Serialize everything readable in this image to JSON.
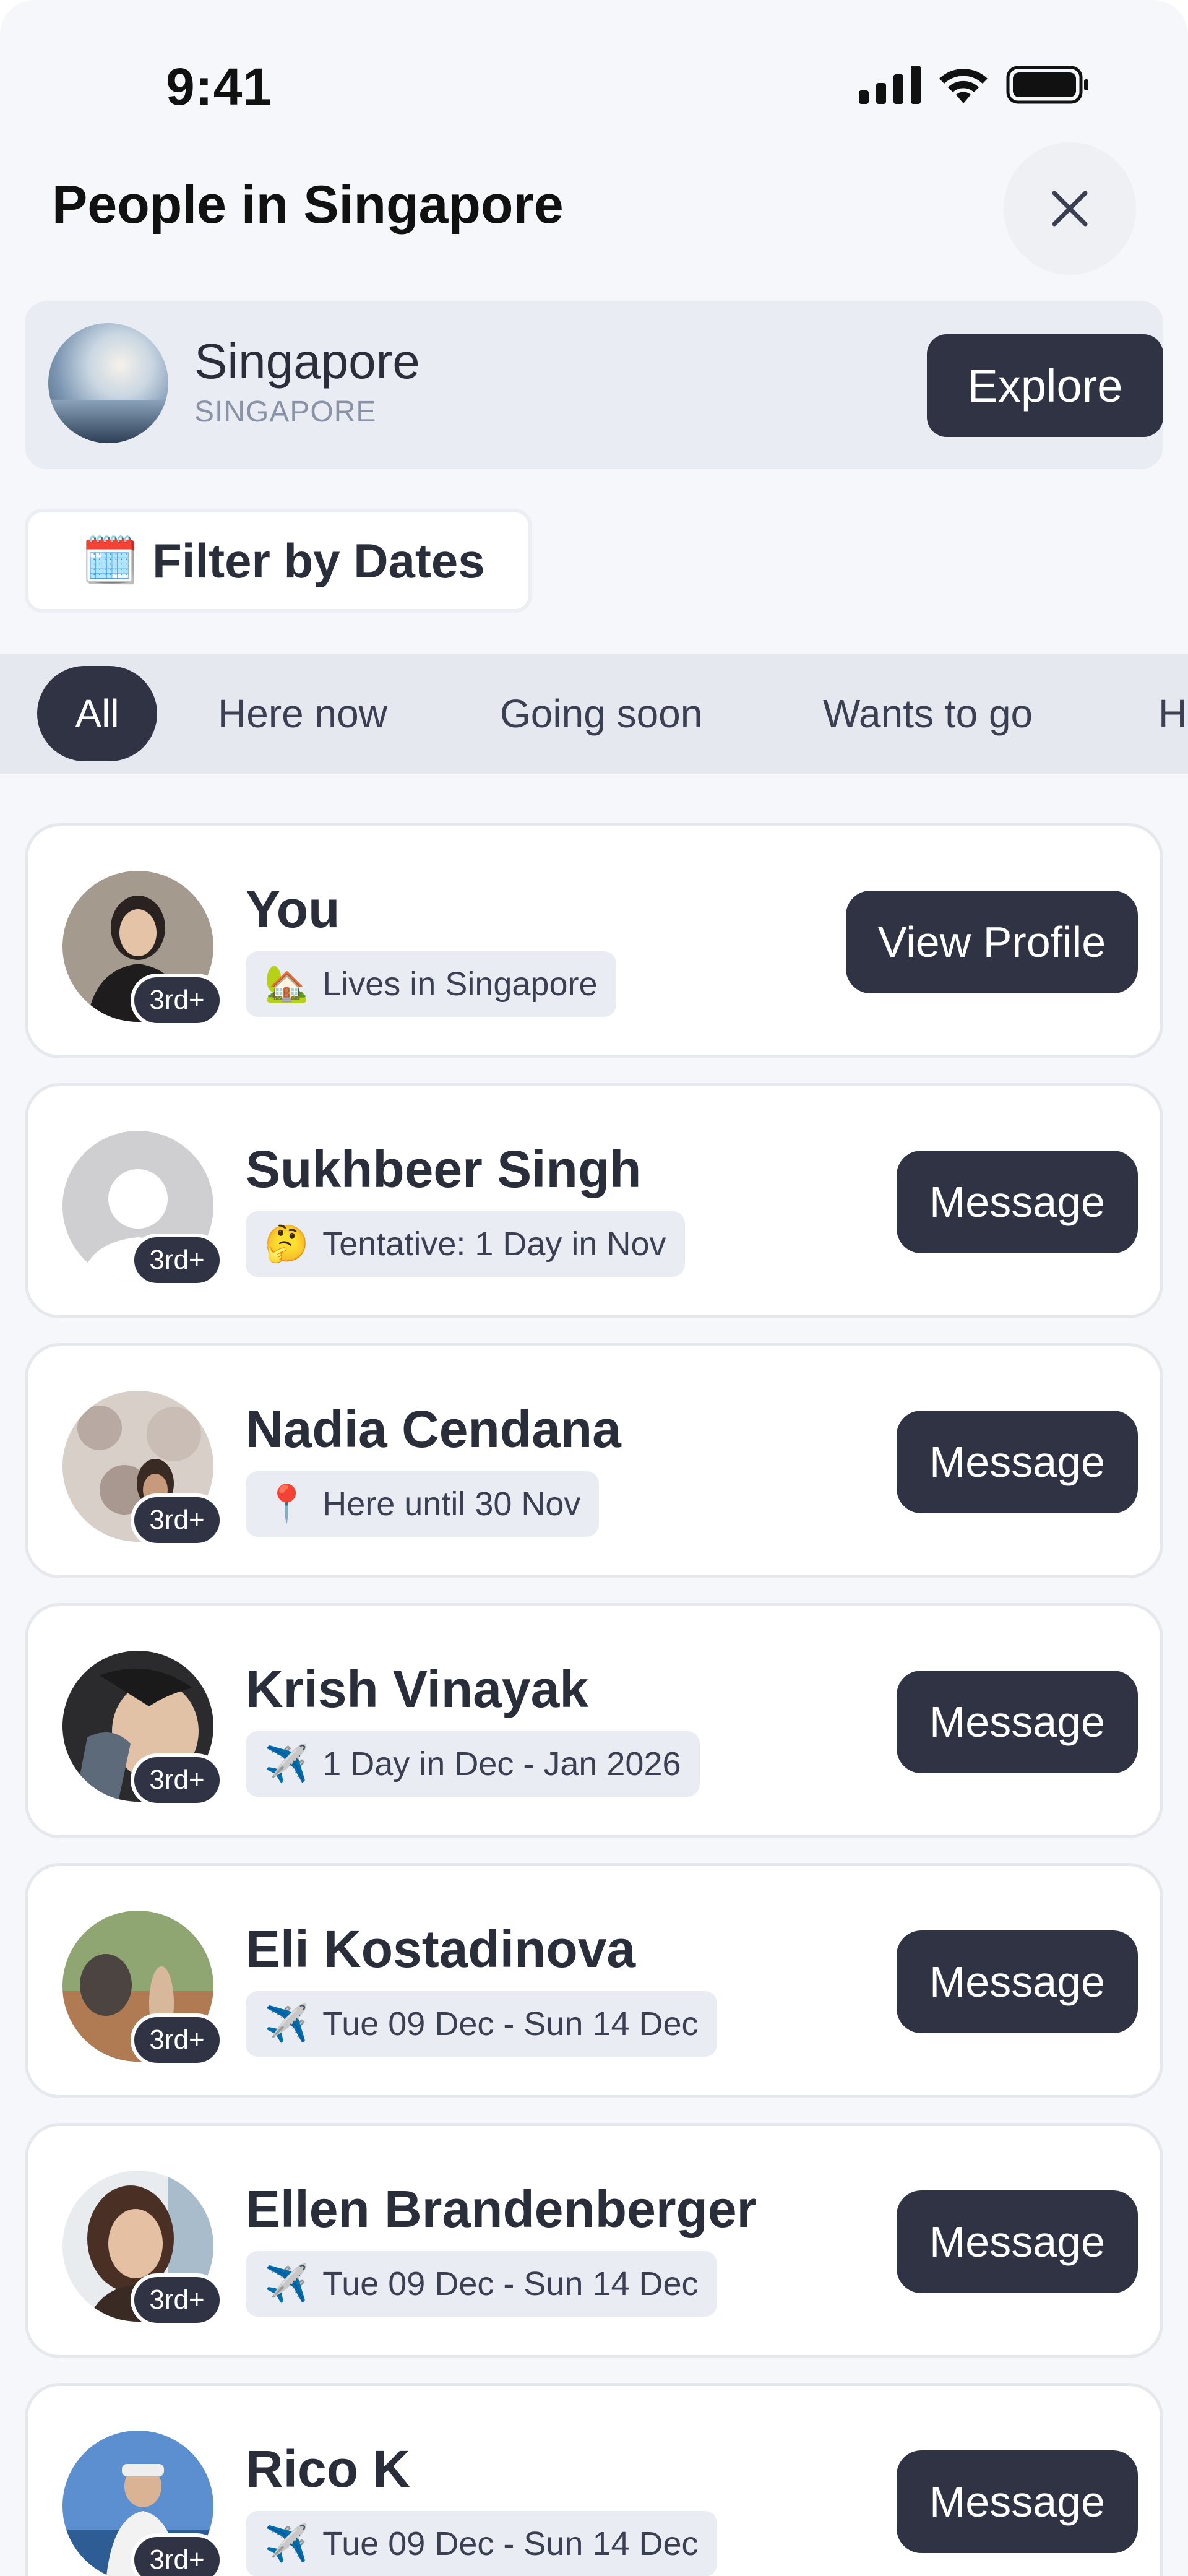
{
  "status_bar": {
    "time": "9:41"
  },
  "header": {
    "title": "People in Singapore"
  },
  "location": {
    "name": "Singapore",
    "country": "SINGAPORE",
    "explore_label": "Explore"
  },
  "filter": {
    "icon": "🗓️",
    "label": "Filter by Dates"
  },
  "tabs": [
    {
      "label": "All",
      "active": true
    },
    {
      "label": "Here now",
      "active": false
    },
    {
      "label": "Going soon",
      "active": false
    },
    {
      "label": "Wants to go",
      "active": false
    },
    {
      "label": "H",
      "active": false
    }
  ],
  "people": [
    {
      "name": "You",
      "badge": "3rd+",
      "status_icon": "🏡",
      "status": "Lives in Singapore",
      "action": "View Profile"
    },
    {
      "name": "Sukhbeer Singh",
      "badge": "3rd+",
      "status_icon": "🤔",
      "status": "Tentative: 1 Day in Nov",
      "action": "Message"
    },
    {
      "name": "Nadia Cendana",
      "badge": "3rd+",
      "status_icon": "📍",
      "status": "Here until 30 Nov",
      "action": "Message"
    },
    {
      "name": "Krish Vinayak",
      "badge": "3rd+",
      "status_icon": "✈️",
      "status": "1 Day in Dec - Jan 2026",
      "action": "Message"
    },
    {
      "name": "Eli Kostadinova",
      "badge": "3rd+",
      "status_icon": "✈️",
      "status": "Tue 09 Dec - Sun 14 Dec",
      "action": "Message"
    },
    {
      "name": "Ellen Brandenberger",
      "badge": "3rd+",
      "status_icon": "✈️",
      "status": "Tue 09 Dec - Sun 14 Dec",
      "action": "Message"
    },
    {
      "name": "Rico K",
      "badge": "3rd+",
      "status_icon": "✈️",
      "status": "Tue 09 Dec - Sun 14 Dec",
      "action": "Message"
    }
  ]
}
